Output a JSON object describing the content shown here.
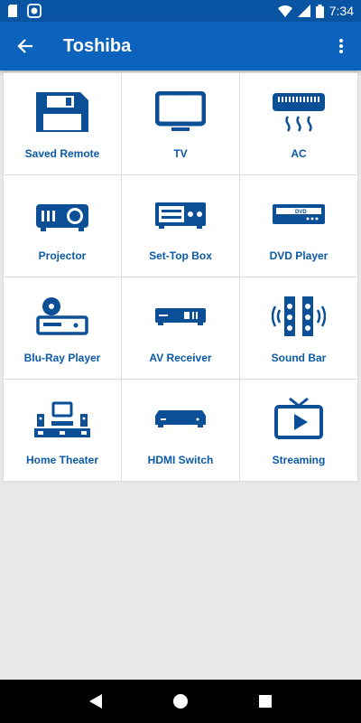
{
  "status_bar": {
    "time": "7:34"
  },
  "app_bar": {
    "title": "Toshiba"
  },
  "devices": [
    {
      "label": "Saved Remote",
      "icon": "floppy-disk-icon"
    },
    {
      "label": "TV",
      "icon": "tv-icon"
    },
    {
      "label": "AC",
      "icon": "air-conditioner-icon"
    },
    {
      "label": "Projector",
      "icon": "projector-icon"
    },
    {
      "label": "Set-Top Box",
      "icon": "set-top-box-icon"
    },
    {
      "label": "DVD Player",
      "icon": "dvd-player-icon"
    },
    {
      "label": "Blu-Ray Player",
      "icon": "blu-ray-player-icon"
    },
    {
      "label": "AV Receiver",
      "icon": "av-receiver-icon"
    },
    {
      "label": "Sound Bar",
      "icon": "sound-bar-icon"
    },
    {
      "label": "Home Theater",
      "icon": "home-theater-icon"
    },
    {
      "label": "HDMI Switch",
      "icon": "hdmi-switch-icon"
    },
    {
      "label": "Streaming",
      "icon": "streaming-icon"
    }
  ],
  "dvd_text": "DVD",
  "colors": {
    "primary": "#0b63bd",
    "status": "#0a55a3",
    "icon": "#0b4f96",
    "label": "#0b5aa8"
  }
}
